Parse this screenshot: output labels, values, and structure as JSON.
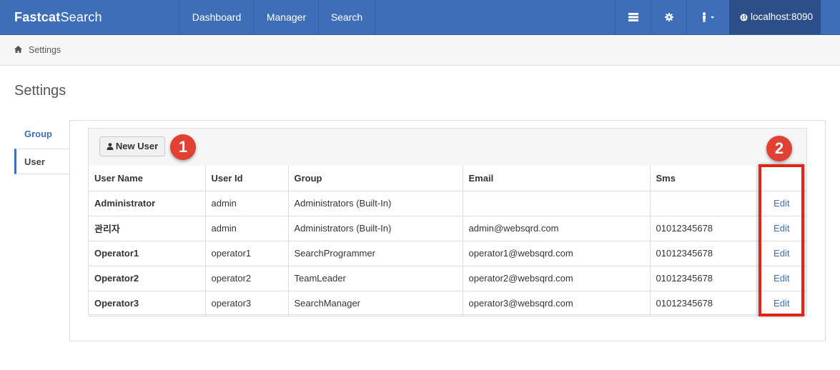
{
  "navbar": {
    "brand_bold": "Fastcat",
    "brand_rest": "Search",
    "items": [
      {
        "label": "Dashboard"
      },
      {
        "label": "Manager"
      },
      {
        "label": "Search"
      }
    ],
    "host": "localhost:8090",
    "icons": [
      "list-icon",
      "gear-icon",
      "user-dropdown-icon",
      "globe-icon"
    ],
    "color": "#3e6eb8"
  },
  "breadcrumb": {
    "icon": "home-icon",
    "current": "Settings"
  },
  "page": {
    "title": "Settings"
  },
  "tabs": [
    {
      "label": "Group"
    },
    {
      "label": "User"
    }
  ],
  "toolbar": {
    "new_user_label": "New User"
  },
  "markers": [
    "1",
    "2"
  ],
  "table": {
    "columns": [
      "User Name",
      "User Id",
      "Group",
      "Email",
      "Sms",
      ""
    ],
    "rows": [
      {
        "name": "Administrator",
        "id": "admin",
        "group": "Administrators (Built-In)",
        "email": "",
        "sms": "",
        "action": "Edit"
      },
      {
        "name": "관리자",
        "id": "admin",
        "group": "Administrators (Built-In)",
        "email": "admin@websqrd.com",
        "sms": "01012345678",
        "action": "Edit"
      },
      {
        "name": "Operator1",
        "id": "operator1",
        "group": "SearchProgrammer",
        "email": "operator1@websqrd.com",
        "sms": "01012345678",
        "action": "Edit"
      },
      {
        "name": "Operator2",
        "id": "operator2",
        "group": "TeamLeader",
        "email": "operator2@websqrd.com",
        "sms": "01012345678",
        "action": "Edit"
      },
      {
        "name": "Operator3",
        "id": "operator3",
        "group": "SearchManager",
        "email": "operator3@websqrd.com",
        "sms": "01012345678",
        "action": "Edit"
      }
    ]
  },
  "annotation_color": "#e02416"
}
